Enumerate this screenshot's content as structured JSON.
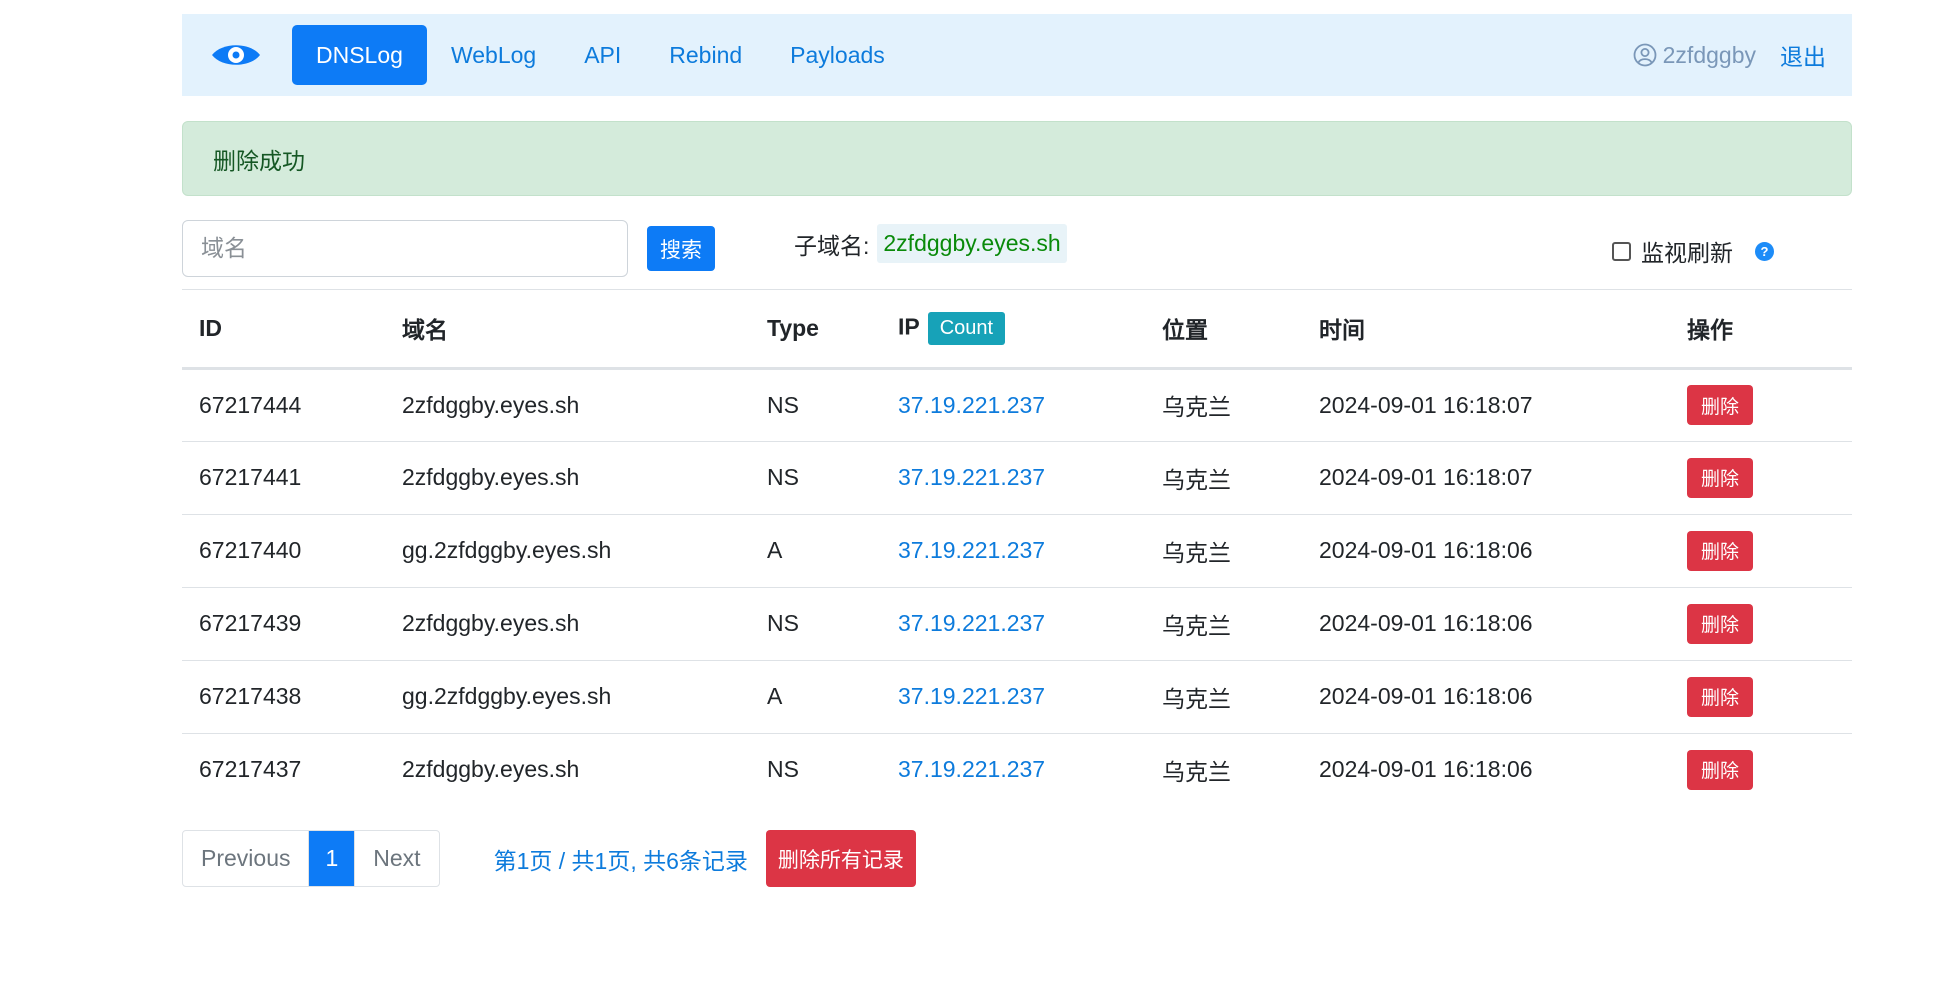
{
  "navbar": {
    "brand_icon": "eye-icon",
    "items": [
      {
        "label": "DNSLog",
        "active": true
      },
      {
        "label": "WebLog",
        "active": false
      },
      {
        "label": "API",
        "active": false
      },
      {
        "label": "Rebind",
        "active": false
      },
      {
        "label": "Payloads",
        "active": false
      }
    ],
    "username": "2zfdggby",
    "logout_label": "退出"
  },
  "alert": {
    "message": "删除成功"
  },
  "search": {
    "placeholder": "域名",
    "button_label": "搜索",
    "subdomain_label": "子域名:",
    "subdomain_value": "2zfdggby.eyes.sh",
    "monitor_label": "监视刷新",
    "monitor_checked": false
  },
  "table": {
    "headers": {
      "id": "ID",
      "domain": "域名",
      "type": "Type",
      "ip": "IP",
      "count": "Count",
      "location": "位置",
      "time": "时间",
      "action": "操作"
    },
    "delete_label": "删除",
    "rows": [
      {
        "id": "67217444",
        "domain": "2zfdggby.eyes.sh",
        "type": "NS",
        "ip": "37.19.221.237",
        "location": "乌克兰",
        "time": "2024-09-01 16:18:07"
      },
      {
        "id": "67217441",
        "domain": "2zfdggby.eyes.sh",
        "type": "NS",
        "ip": "37.19.221.237",
        "location": "乌克兰",
        "time": "2024-09-01 16:18:07"
      },
      {
        "id": "67217440",
        "domain": "gg.2zfdggby.eyes.sh",
        "type": "A",
        "ip": "37.19.221.237",
        "location": "乌克兰",
        "time": "2024-09-01 16:18:06"
      },
      {
        "id": "67217439",
        "domain": "2zfdggby.eyes.sh",
        "type": "NS",
        "ip": "37.19.221.237",
        "location": "乌克兰",
        "time": "2024-09-01 16:18:06"
      },
      {
        "id": "67217438",
        "domain": "gg.2zfdggby.eyes.sh",
        "type": "A",
        "ip": "37.19.221.237",
        "location": "乌克兰",
        "time": "2024-09-01 16:18:06"
      },
      {
        "id": "67217437",
        "domain": "2zfdggby.eyes.sh",
        "type": "NS",
        "ip": "37.19.221.237",
        "location": "乌克兰",
        "time": "2024-09-01 16:18:06"
      }
    ]
  },
  "pagination": {
    "previous_label": "Previous",
    "current_page": "1",
    "next_label": "Next",
    "info": "第1页 / 共1页, 共6条记录",
    "delete_all_label": "删除所有记录"
  },
  "colors": {
    "primary": "#0d7bf6",
    "danger": "#dc3545",
    "info": "#17a2b8",
    "navbar_bg": "#e3f2fd",
    "success_bg": "#d4ebdb"
  }
}
